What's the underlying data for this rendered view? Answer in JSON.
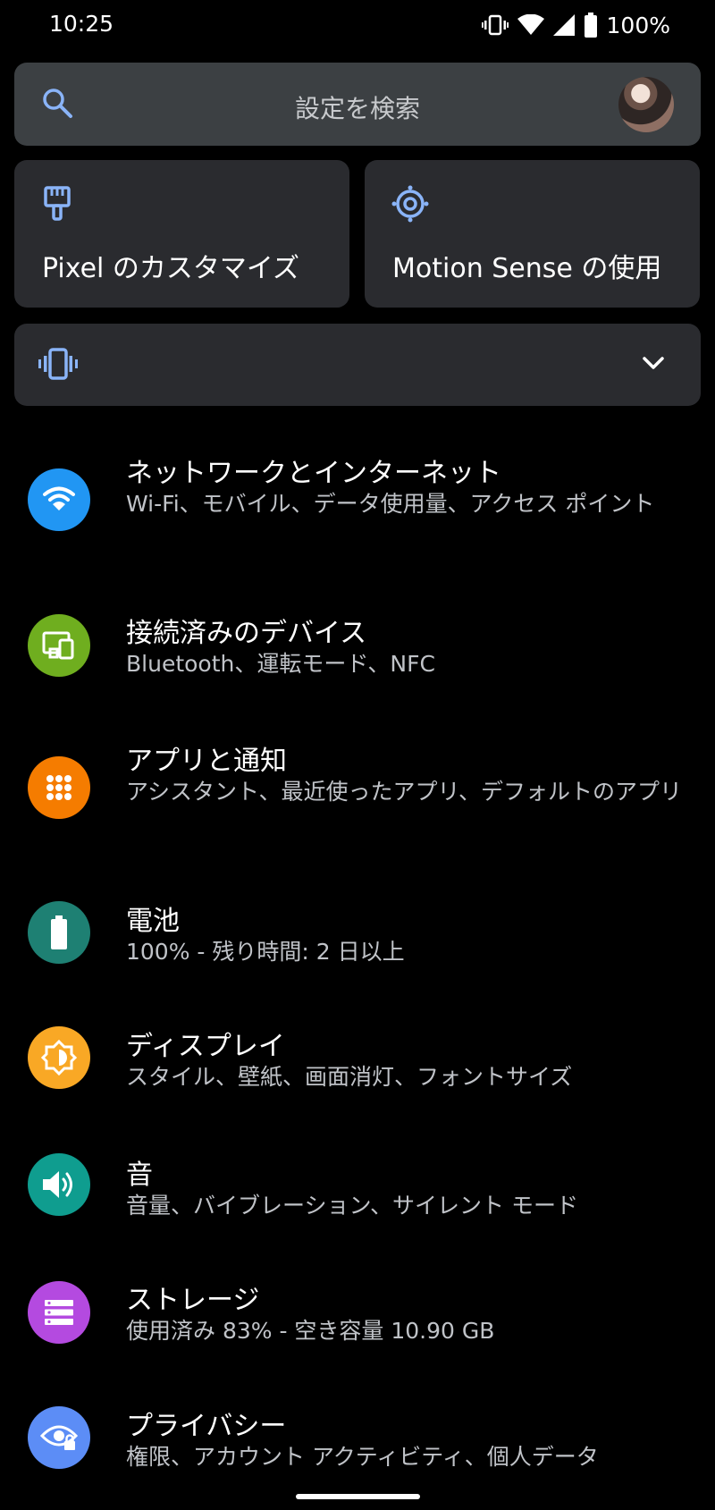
{
  "status_bar": {
    "time": "10:25",
    "battery_percent": "100%"
  },
  "search": {
    "placeholder": "設定を検索",
    "icon": "search-icon"
  },
  "suggestion_cards": [
    {
      "label": "Pixel のカスタマイズ",
      "icon": "paintbrush-icon"
    },
    {
      "label": "Motion Sense の使用",
      "icon": "motion-sense-icon"
    }
  ],
  "vibrate_row": {
    "icon": "vibrate-icon",
    "expand_icon": "chevron-down-icon"
  },
  "settings": [
    {
      "title": "ネットワークとインターネット",
      "subtitle": "Wi-Fi、モバイル、データ使用量、アクセス ポイント",
      "icon": "wifi-icon",
      "color": "#2196f3"
    },
    {
      "title": "接続済みのデバイス",
      "subtitle": "Bluetooth、運転モード、NFC",
      "icon": "devices-icon",
      "color": "#6fae1f"
    },
    {
      "title": "アプリと通知",
      "subtitle": "アシスタント、最近使ったアプリ、デフォルトのアプリ",
      "icon": "apps-grid-icon",
      "color": "#f57c00"
    },
    {
      "title": "電池",
      "subtitle": "100% - 残り時間: 2 日以上",
      "icon": "battery-icon",
      "color": "#1e8073"
    },
    {
      "title": "ディスプレイ",
      "subtitle": "スタイル、壁紙、画面消灯、フォントサイズ",
      "icon": "brightness-icon",
      "color": "#f9a825"
    },
    {
      "title": "音",
      "subtitle": "音量、バイブレーション、サイレント モード",
      "icon": "volume-icon",
      "color": "#0f9d8f"
    },
    {
      "title": "ストレージ",
      "subtitle": "使用済み 83% - 空き容量 10.90 GB",
      "icon": "storage-icon",
      "color": "#b44ae0"
    },
    {
      "title": "プライバシー",
      "subtitle": "権限、アカウント アクティビティ、個人データ",
      "icon": "privacy-eye-icon",
      "color": "#5c8df6"
    }
  ]
}
